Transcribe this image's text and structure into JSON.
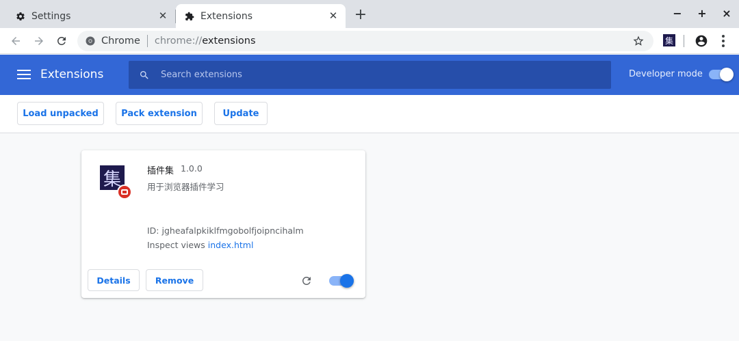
{
  "tabs": [
    {
      "title": "Settings",
      "icon": "gear-icon",
      "active": false
    },
    {
      "title": "Extensions",
      "icon": "puzzle-icon",
      "active": true
    }
  ],
  "window_controls": {
    "minimize": "−",
    "maximize": "+",
    "close": "×"
  },
  "toolbar": {
    "omnibox_site": "Chrome",
    "url_scheme": "chrome://",
    "url_host": "extensions",
    "extension_icon_glyph": "集"
  },
  "header": {
    "title": "Extensions",
    "search_placeholder": "Search extensions",
    "developer_mode_label": "Developer mode",
    "developer_mode_on": true
  },
  "actions": {
    "load_unpacked": "Load unpacked",
    "pack_extension": "Pack extension",
    "update": "Update"
  },
  "extension": {
    "icon_glyph": "集",
    "name": "插件集",
    "version": "1.0.0",
    "description": "用于浏览器插件学习",
    "id_text": "ID: jgheafalpkiklfmgobolfjoipncihalm",
    "inspect_label": "Inspect views",
    "inspect_link": "index.html",
    "details_label": "Details",
    "remove_label": "Remove",
    "enabled": true
  },
  "colors": {
    "header_blue": "#3367d6",
    "search_bg": "#264eaa",
    "link_blue": "#1a73e8",
    "badge_red": "#d93025"
  }
}
